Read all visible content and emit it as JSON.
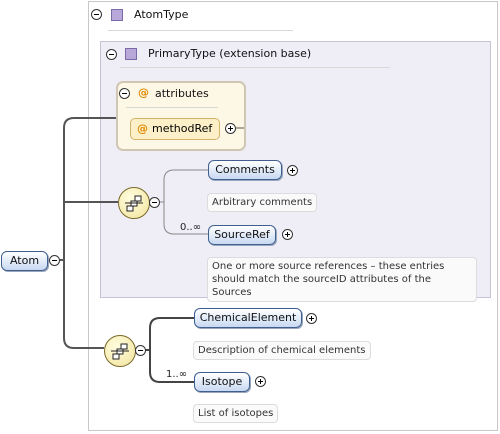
{
  "root": {
    "label": "Atom"
  },
  "atom_type": {
    "label": "AtomType"
  },
  "primary_type": {
    "label": "PrimaryType (extension base)"
  },
  "attributes": {
    "group_label": "attributes",
    "at_symbol": "@",
    "method_ref_label": "methodRef"
  },
  "elements": {
    "comments": {
      "label": "Comments",
      "doc": "Arbitrary comments"
    },
    "source_ref": {
      "label": "SourceRef",
      "cardinality": "0..∞",
      "doc_line1": "One or more source references – these entries",
      "doc_line2": "should match the sourceID attributes of the Sources"
    },
    "chemical_element": {
      "label": "ChemicalElement",
      "doc": "Description of chemical elements"
    },
    "isotope": {
      "label": "Isotope",
      "cardinality": "1..∞",
      "doc": "List of isotopes"
    }
  },
  "icons": {
    "expanded_toggle": "minus-circle-icon",
    "collapsed_toggle": "plus-circle-icon",
    "complex_type": "type-square-icon",
    "sequence": "sequence-compositor-icon"
  },
  "colors": {
    "element_fill": "#c8d9f2",
    "attribute_fill": "#fdf0c8",
    "type_square": "#b8a8d9",
    "sequence_fill": "#f1e39a"
  }
}
